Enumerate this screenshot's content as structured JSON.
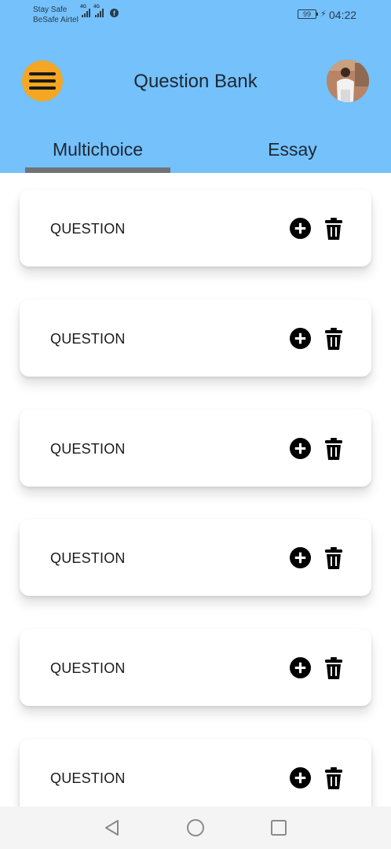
{
  "status_bar": {
    "carrier_line1": "Stay Safe",
    "carrier_line2": "BeSafe Airtel",
    "network1": "4G",
    "network2": "4G",
    "social_icon": "facebook-icon",
    "battery": "99",
    "time": "04:22"
  },
  "header": {
    "title": "Question Bank",
    "menu_icon": "hamburger-icon",
    "menu_color": "#f5a623",
    "background_color": "#74c1fb"
  },
  "tabs": [
    {
      "label": "Multichoice",
      "active": true
    },
    {
      "label": "Essay",
      "active": false
    }
  ],
  "questions": [
    {
      "label": "QUESTION",
      "add_icon": "plus-circle-icon",
      "delete_icon": "trash-icon"
    },
    {
      "label": "QUESTION",
      "add_icon": "plus-circle-icon",
      "delete_icon": "trash-icon"
    },
    {
      "label": "QUESTION",
      "add_icon": "plus-circle-icon",
      "delete_icon": "trash-icon"
    },
    {
      "label": "QUESTION",
      "add_icon": "plus-circle-icon",
      "delete_icon": "trash-icon"
    },
    {
      "label": "QUESTION",
      "add_icon": "plus-circle-icon",
      "delete_icon": "trash-icon"
    },
    {
      "label": "QUESTION",
      "add_icon": "plus-circle-icon",
      "delete_icon": "trash-icon"
    }
  ],
  "navigation": [
    "back-icon",
    "home-icon",
    "recent-apps-icon"
  ]
}
